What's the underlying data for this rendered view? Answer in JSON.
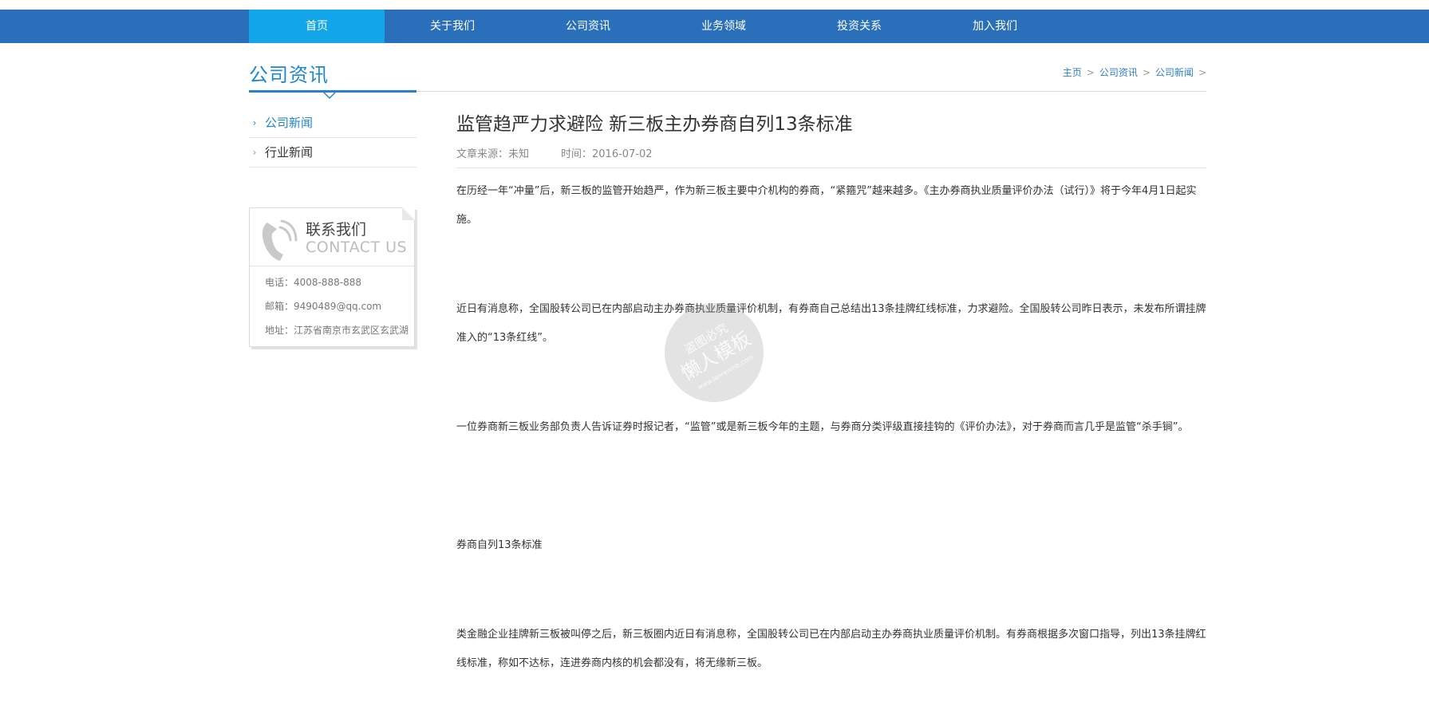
{
  "nav": {
    "items": [
      {
        "label": "首页",
        "active": true
      },
      {
        "label": "关于我们",
        "active": false
      },
      {
        "label": "公司资讯",
        "active": false
      },
      {
        "label": "业务领域",
        "active": false
      },
      {
        "label": "投资关系",
        "active": false
      },
      {
        "label": "加入我们",
        "active": false
      }
    ]
  },
  "section": {
    "title": "公司资讯"
  },
  "breadcrumb": {
    "items": [
      "主页",
      "公司资讯",
      "公司新闻"
    ],
    "separator": ">"
  },
  "sidebar": {
    "items": [
      {
        "label": "公司新闻",
        "active": true
      },
      {
        "label": "行业新闻",
        "active": false
      }
    ]
  },
  "contact": {
    "title_cn": "联系我们",
    "title_en": "CONTACT US",
    "phone": "电话：4008-888-888",
    "email": "邮箱：9490489@qq.com",
    "address": "地址：江苏省南京市玄武区玄武湖"
  },
  "article": {
    "title": "监管趋严力求避险 新三板主办券商自列13条标准",
    "source": "文章来源：未知",
    "time": "时间：2016-07-02",
    "paragraphs": [
      "在历经一年“冲量”后，新三板的监管开始趋严，作为新三板主要中介机构的券商，“紧箍咒”越来越多。《主办券商执业质量评价办法（试行）》将于今年4月1日起实施。",
      "近日有消息称，全国股转公司已在内部启动主办券商执业质量评价机制，有券商自己总结出13条挂牌红线标准，力求避险。全国股转公司昨日表示，未发布所谓挂牌准入的“13条红线”。",
      "一位券商新三板业务部负责人告诉证券时报记者，“监管”或是新三板今年的主题，与券商分类评级直接挂钩的《评价办法》，对于券商而言几乎是监管“杀手锏”。",
      "券商自列13条标准",
      "类金融企业挂牌新三板被叫停之后，新三板圈内近日有消息称，全国股转公司已在内部启动主办券商执业质量评价机制。有券商根据多次窗口指导，列出13条挂牌红线标准，称如不达标，连进券商内核的机会都没有，将无缘新三板。"
    ]
  },
  "watermark": {
    "line1": "盗图必究",
    "line2": "懒人模板",
    "line3": "www.lanrenmb.com"
  },
  "colors": {
    "nav_bg": "#2a6fb9",
    "nav_active": "#12a6e9",
    "accent": "#1e86d1"
  },
  "icons": {
    "contact": "phone-icon",
    "side_chevron": "chevron-right-icon"
  }
}
